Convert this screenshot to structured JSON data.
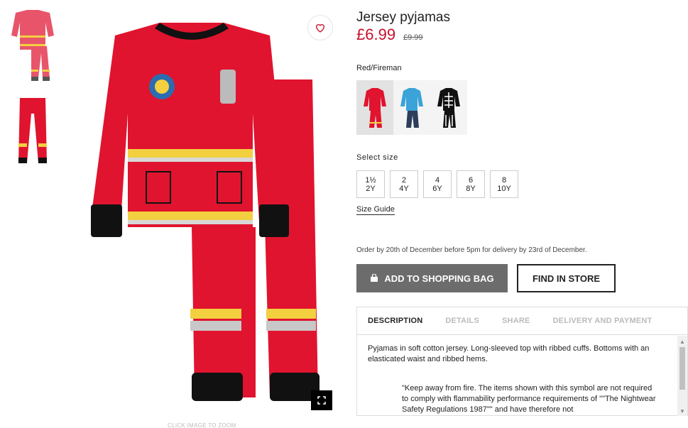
{
  "product": {
    "title": "Jersey pyjamas",
    "price": "£6.99",
    "old_price": "£9.99",
    "color_name": "Red/Fireman"
  },
  "gallery": {
    "zoom_hint": "CLICK IMAGE TO ZOOM",
    "icons": {
      "heart": "heart-icon",
      "zoom": "fullscreen-icon"
    }
  },
  "swatches": [
    {
      "name": "Red/Fireman",
      "selected": true
    },
    {
      "name": "Blue",
      "selected": false
    },
    {
      "name": "Black/Skeleton",
      "selected": false
    }
  ],
  "size": {
    "label": "Select size",
    "options": [
      {
        "line1": "1½",
        "line2": "2Y"
      },
      {
        "line1": "2",
        "line2": "4Y"
      },
      {
        "line1": "4",
        "line2": "6Y"
      },
      {
        "line1": "6",
        "line2": "8Y"
      },
      {
        "line1": "8",
        "line2": "10Y"
      }
    ],
    "guide": "Size Guide"
  },
  "delivery_note": "Order by 20th of December before 5pm for delivery by 23rd of December.",
  "actions": {
    "add_to_bag": "ADD TO SHOPPING BAG",
    "find_in_store": "FIND IN STORE"
  },
  "tabs": {
    "items": [
      "DESCRIPTION",
      "DETAILS",
      "SHARE",
      "DELIVERY AND PAYMENT"
    ],
    "active": "DESCRIPTION"
  },
  "description": {
    "text": "Pyjamas in soft cotton jersey. Long-sleeved top with ribbed cuffs. Bottoms with an elasticated waist and ribbed hems.",
    "quote": "\"Keep away from fire. The items shown with this symbol are not required to comply with flammability performance requirements of \"\"The Nightwear Safety Regulations 1987\"\" and have therefore not"
  },
  "colors": {
    "accent_red": "#c8102e",
    "button_gray": "#6c6c6c"
  }
}
